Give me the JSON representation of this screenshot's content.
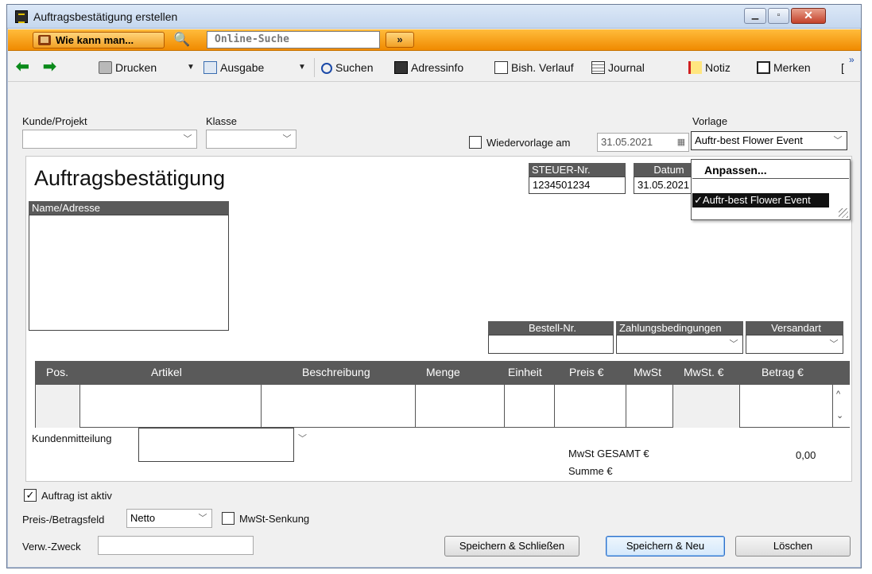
{
  "window": {
    "title": "Auftragsbestätigung erstellen",
    "close_glyph": "✕",
    "min_glyph": "▁",
    "max_glyph": "▫"
  },
  "helpbar": {
    "howto_label": "Wie kann man...",
    "search_placeholder": "Online-Suche",
    "go_label": "»"
  },
  "toolbar": {
    "back_glyph": "⬅",
    "forward_glyph": "➡",
    "print_label": "Drucken",
    "output_label": "Ausgabe",
    "search_label": "Suchen",
    "addressinfo_label": "Adressinfo",
    "history_label": "Bish. Verlauf",
    "journal_label": "Journal",
    "note_label": "Notiz",
    "remember_label": "Merken",
    "overflow_glyph": "»",
    "caret_glyph": "▼",
    "bracket_glyph": "["
  },
  "form": {
    "customer_label": "Kunde/Projekt",
    "customer_value": "",
    "class_label": "Klasse",
    "class_value": "",
    "followup_label": "Wiedervorlage am",
    "followup_checked": false,
    "followup_date": "31.05.2021",
    "template_label": "Vorlage",
    "template_value": "Auftr-best Flower Event"
  },
  "template_dropdown": {
    "items": [
      "Anpassen...",
      "",
      "✓Auftr-best Flower Event"
    ]
  },
  "document": {
    "title": "Auftragsbestätigung",
    "tax_header": "STEUER-Nr.",
    "tax_value": "1234501234",
    "date_header": "Datum",
    "date_value": "31.05.2021",
    "address_header": "Name/Adresse",
    "order_no_header": "Bestell-Nr.",
    "payment_header": "Zahlungsbedingungen",
    "shipping_header": "Versandart",
    "columns": [
      "Pos.",
      "Artikel",
      "Beschreibung",
      "Menge",
      "Einheit",
      "Preis €",
      "MwSt",
      "MwSt. €",
      "Betrag €"
    ],
    "customer_message_label": "Kundenmitteilung",
    "vat_total_label": "MwSt GESAMT €",
    "vat_total_value": "0,00",
    "sum_label": "Summe €"
  },
  "footer": {
    "active_label": "Auftrag ist aktiv",
    "active_checked": true,
    "price_field_label": "Preis-/Betragsfeld",
    "price_field_value": "Netto",
    "vat_reduction_label": "MwSt-Senkung",
    "vat_reduction_checked": false,
    "purpose_label": "Verw.-Zweck",
    "purpose_value": "",
    "save_close_label": "Speichern & Schließen",
    "save_new_label": "Speichern & Neu",
    "delete_label": "Löschen"
  },
  "glyphs": {
    "dropdown": "﹀",
    "check": "✓",
    "calendar": "▦",
    "up": "^",
    "down": "⌄"
  }
}
